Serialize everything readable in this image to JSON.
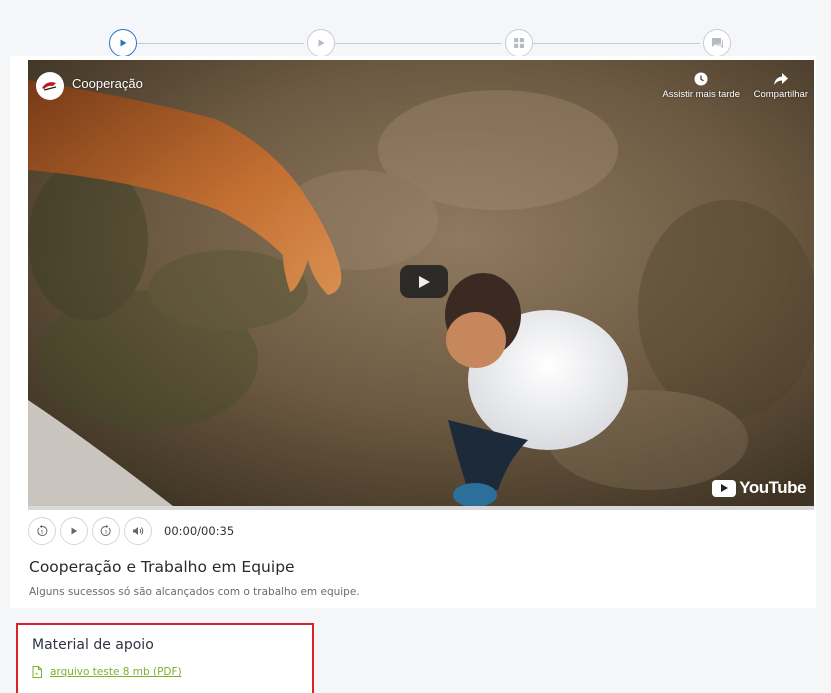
{
  "colors": {
    "accent_blue": "#2a73c7",
    "highlight_red": "#d9232b",
    "link_green": "#7fb02a"
  },
  "stepper": {
    "steps": [
      {
        "icon": "play-icon",
        "state": "active"
      },
      {
        "icon": "play-icon",
        "state": "inactive"
      },
      {
        "icon": "grid-icon",
        "state": "inactive"
      },
      {
        "icon": "chat-icon",
        "state": "inactive"
      }
    ]
  },
  "video": {
    "channel_title": "Cooperação",
    "watch_later_label": "Assistir mais tarde",
    "share_label": "Compartilhar",
    "logo_text": "YouTube"
  },
  "player": {
    "time": "00:00/00:35",
    "buttons": [
      "rewind-5-icon",
      "play-icon",
      "forward-5-icon",
      "volume-icon"
    ]
  },
  "lesson": {
    "title": "Cooperação e Trabalho em Equipe",
    "description": "Alguns sucessos só são alcançados com o trabalho em equipe."
  },
  "material": {
    "heading": "Material de apoio",
    "file_label": "arquivo teste 8 mb (PDF)"
  }
}
